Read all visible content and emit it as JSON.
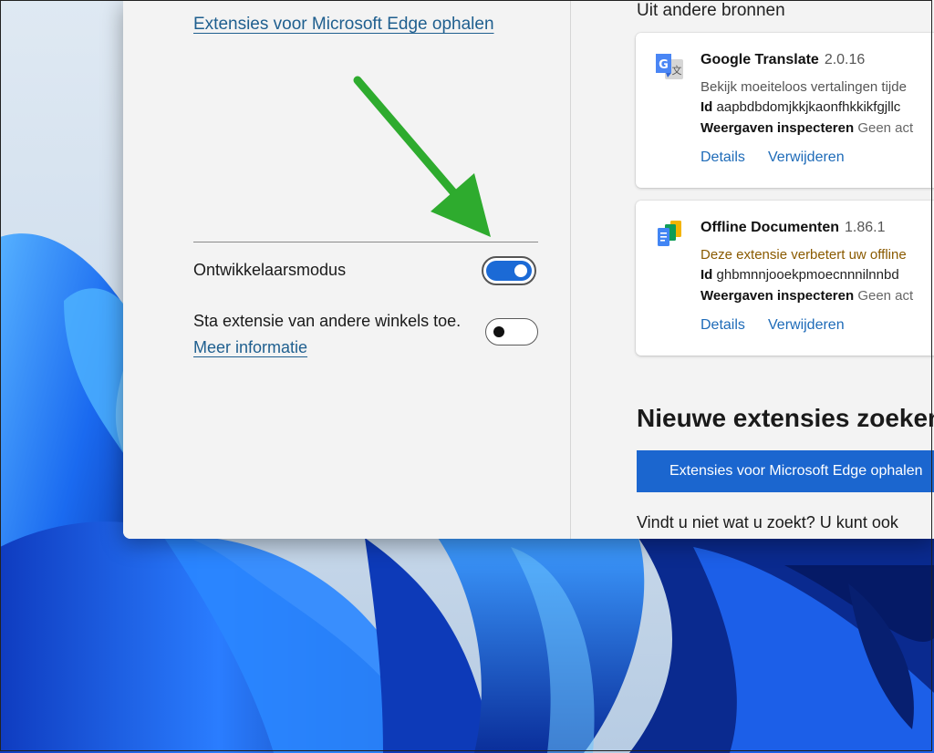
{
  "left": {
    "get_link": "Extensies voor Microsoft Edge ophalen",
    "dev_mode_label": "Ontwikkelaarsmodus",
    "dev_mode_on": true,
    "other_stores_label": "Sta extensie van andere winkels toe.",
    "more_info_link": "Meer informatie",
    "other_stores_on": false
  },
  "right": {
    "section_title": "Uit andere bronnen",
    "extensions": [
      {
        "name": "Google Translate",
        "version": "2.0.16",
        "description": "Bekijk moeiteloos vertalingen tijde",
        "id_label": "Id",
        "id_value": "aapbdbdomjkkjkaonfhkkikfgjllc",
        "inspect_label": "Weergaven inspecteren",
        "inspect_value": "Geen act",
        "details": "Details",
        "remove": "Verwijderen",
        "icon": "google-translate-icon"
      },
      {
        "name": "Offline Documenten",
        "version": "1.86.1",
        "description": "Deze extensie verbetert uw offline",
        "id_label": "Id",
        "id_value": "ghbmnnjooekpmoecnnnilnnbd",
        "inspect_label": "Weergaven inspecteren",
        "inspect_value": "Geen act",
        "details": "Details",
        "remove": "Verwijderen",
        "icon": "google-docs-icon"
      }
    ],
    "new_title": "Nieuwe extensies zoeken",
    "edge_button": "Extensies voor Microsoft Edge ophalen",
    "find_text": "Vindt u niet wat u zoekt? U kunt ook"
  },
  "colors": {
    "accent": "#1b66cf",
    "link": "#1f5f8f",
    "arrow": "#2eab2e",
    "wallpaper": "#1a4fd0"
  }
}
